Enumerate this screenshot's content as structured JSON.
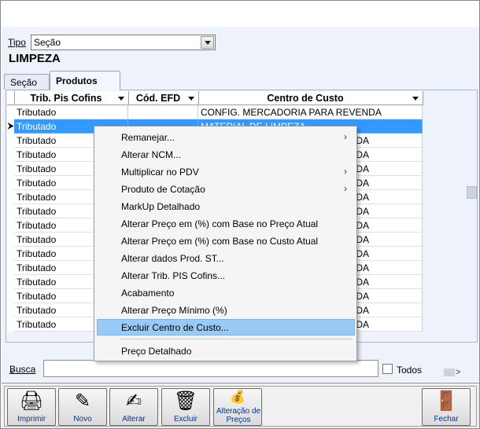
{
  "filter": {
    "tipo_label": "Tipo",
    "tipo_value": "Seção",
    "section_name": "LIMPEZA"
  },
  "tabs": [
    {
      "label": "Seção",
      "active": false
    },
    {
      "label": "Produtos",
      "active": true
    }
  ],
  "grid": {
    "columns": [
      "Trib. Pis Cofins",
      "Cód. EFD",
      "Centro de Custo"
    ],
    "rows": [
      {
        "trib": "Tributado",
        "cod": "",
        "centro": "CONFIG. MERCADORIA PARA REVENDA"
      },
      {
        "trib": "Tributado",
        "cod": "",
        "centro": "MATERIAL DE LIMPEZA"
      },
      {
        "trib": "Tributado",
        "cod": "",
        "centro": "DA"
      },
      {
        "trib": "Tributado",
        "cod": "",
        "centro": "DA"
      },
      {
        "trib": "Tributado",
        "cod": "",
        "centro": "DA"
      },
      {
        "trib": "Tributado",
        "cod": "",
        "centro": "DA"
      },
      {
        "trib": "Tributado",
        "cod": "",
        "centro": "DA"
      },
      {
        "trib": "Tributado",
        "cod": "",
        "centro": "DA"
      },
      {
        "trib": "Tributado",
        "cod": "",
        "centro": "DA"
      },
      {
        "trib": "Tributado",
        "cod": "",
        "centro": "DA"
      },
      {
        "trib": "Tributado",
        "cod": "",
        "centro": "DA"
      },
      {
        "trib": "Tributado",
        "cod": "",
        "centro": "DA"
      },
      {
        "trib": "Tributado",
        "cod": "",
        "centro": "DA"
      },
      {
        "trib": "Tributado",
        "cod": "",
        "centro": "DA"
      },
      {
        "trib": "Tributado",
        "cod": "",
        "centro": "DA"
      },
      {
        "trib": "Tributado",
        "cod": "",
        "centro": "DA"
      }
    ],
    "selected_index": 1,
    "current_row_marker": "⮞"
  },
  "context_menu": {
    "items": [
      {
        "label": "Remanejar...",
        "submenu": true
      },
      {
        "label": "Alterar NCM...",
        "submenu": false
      },
      {
        "label": "Multiplicar no PDV",
        "submenu": true
      },
      {
        "label": "Produto de Cotação",
        "submenu": true
      },
      {
        "label": "MarkUp Detalhado",
        "submenu": false
      },
      {
        "label": "Alterar Preço em (%) com Base no Preço Atual",
        "submenu": false
      },
      {
        "label": "Alterar Preço em (%) com Base no Custo Atual",
        "submenu": false
      },
      {
        "label": "Alterar dados Prod. ST...",
        "submenu": false
      },
      {
        "label": "Alterar Trib. PIS Cofins...",
        "submenu": false
      },
      {
        "label": "Acabamento",
        "submenu": false
      },
      {
        "label": "Alterar Preço Mínimo (%)",
        "submenu": false
      },
      {
        "label": "Excluir Centro de Custo...",
        "submenu": false,
        "hover": true
      },
      {
        "label": "Preço Detalhado",
        "submenu": false
      }
    ],
    "submenu_arrow": "›"
  },
  "scroll": {
    "left_arrow": "<",
    "right_arrow": ">"
  },
  "search": {
    "label": "Busca",
    "value": "",
    "todos_label": "Todos",
    "todos_checked": false
  },
  "toolbar": {
    "buttons": [
      {
        "name": "imprimir",
        "label": "Imprimir",
        "icon": "🖨"
      },
      {
        "name": "novo",
        "label": "Novo",
        "icon": "✎"
      },
      {
        "name": "alterar",
        "label": "Alterar",
        "icon": "✍"
      },
      {
        "name": "excluir",
        "label": "Excluir",
        "icon": "🗑"
      },
      {
        "name": "alteracao-precos",
        "label": "Alteração de Preços",
        "icon": "💰"
      },
      {
        "name": "fechar",
        "label": "Fechar",
        "icon": "🚪"
      }
    ]
  },
  "colors": {
    "selection": "#3399ff",
    "menu_hover": "#99c9f5",
    "label_blue": "#003399",
    "background": "#eef2fb"
  }
}
